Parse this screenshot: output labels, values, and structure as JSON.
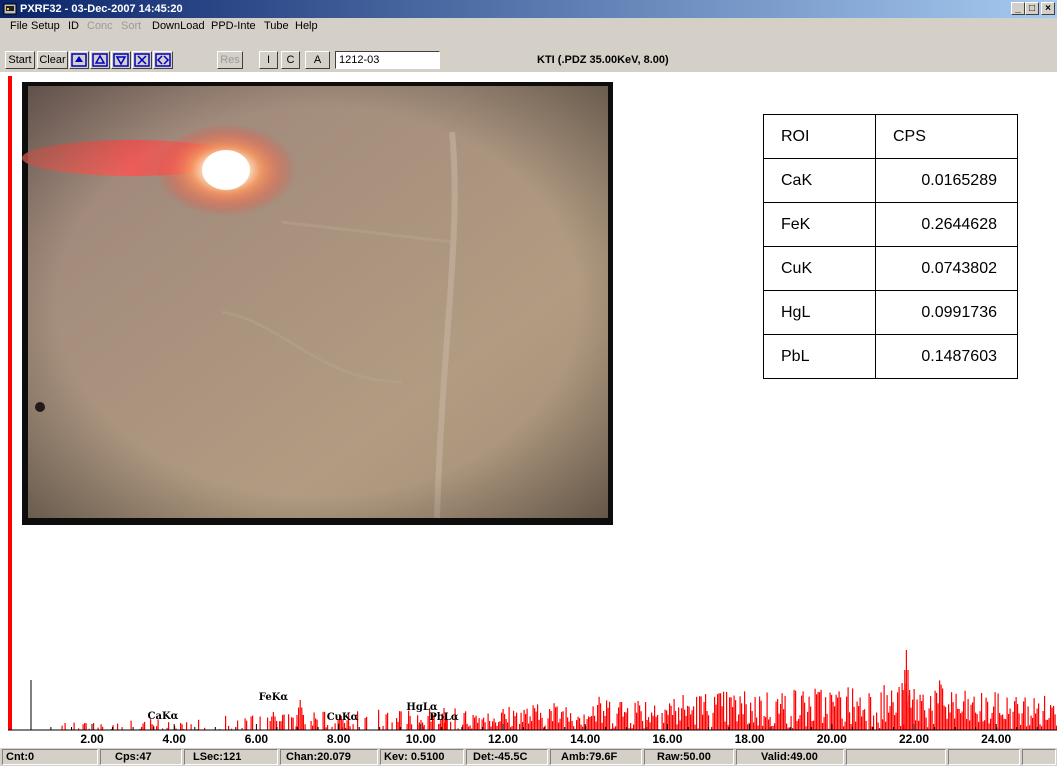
{
  "window": {
    "title": "PXRF32 - 03-Dec-2007 14:45:20",
    "minimize": "_",
    "restore": "□",
    "close": "×"
  },
  "menu": [
    {
      "label": "File",
      "enabled": true
    },
    {
      "label": "Setup",
      "enabled": true
    },
    {
      "label": "ID",
      "enabled": true
    },
    {
      "label": "Conc",
      "enabled": false
    },
    {
      "label": "Sort",
      "enabled": false
    },
    {
      "label": "DownLoad",
      "enabled": true
    },
    {
      "label": "PPD-Inte",
      "enabled": true
    },
    {
      "label": "Tube",
      "enabled": true
    },
    {
      "label": "Help",
      "enabled": true
    }
  ],
  "toolbar": {
    "start": "Start",
    "clear": "Clear",
    "res": "Res",
    "i": "I",
    "c": "C",
    "a": "A",
    "sample_id": "1212-03",
    "config": "KTI (.PDZ 35.00KeV, 8.00)"
  },
  "roi_table": {
    "headers": [
      "ROI",
      "CPS"
    ],
    "rows": [
      [
        "CaK",
        "0.0165289"
      ],
      [
        "FeK",
        "0.2644628"
      ],
      [
        "CuK",
        "0.0743802"
      ],
      [
        "HgL",
        "0.0991736"
      ],
      [
        "PbL",
        "0.1487603"
      ]
    ]
  },
  "chart_data": {
    "type": "bar",
    "title": "",
    "xlabel": "",
    "ylabel": "",
    "xlim": [
      0.3,
      25.3
    ],
    "x_ticks": [
      "2.00",
      "4.00",
      "6.00",
      "8.00",
      "10.00",
      "12.00",
      "14.00",
      "16.00",
      "18.00",
      "20.00",
      "22.00",
      "24.00"
    ],
    "x_tick_values": [
      2,
      4,
      6,
      8,
      10,
      12,
      14,
      16,
      18,
      20,
      22,
      24
    ],
    "annotations": [
      {
        "label": "CaKα",
        "x": 3.69
      },
      {
        "label": "FeKα",
        "x": 6.4
      },
      {
        "label": "CuKα",
        "x": 8.05
      },
      {
        "label": "HgLα",
        "x": 9.99
      },
      {
        "label": "PbLα",
        "x": 10.55
      }
    ],
    "series_color": "#ff0000"
  },
  "status": {
    "cnt": "Cnt:0",
    "cps": "Cps:47",
    "lsec": "LSec:121",
    "chan": "Chan:20.079",
    "kev": "Kev: 0.5100",
    "det": "Det:-45.5C",
    "amb": "Amb:79.6F",
    "raw": "Raw:50.00",
    "valid": "Valid:49.00"
  }
}
